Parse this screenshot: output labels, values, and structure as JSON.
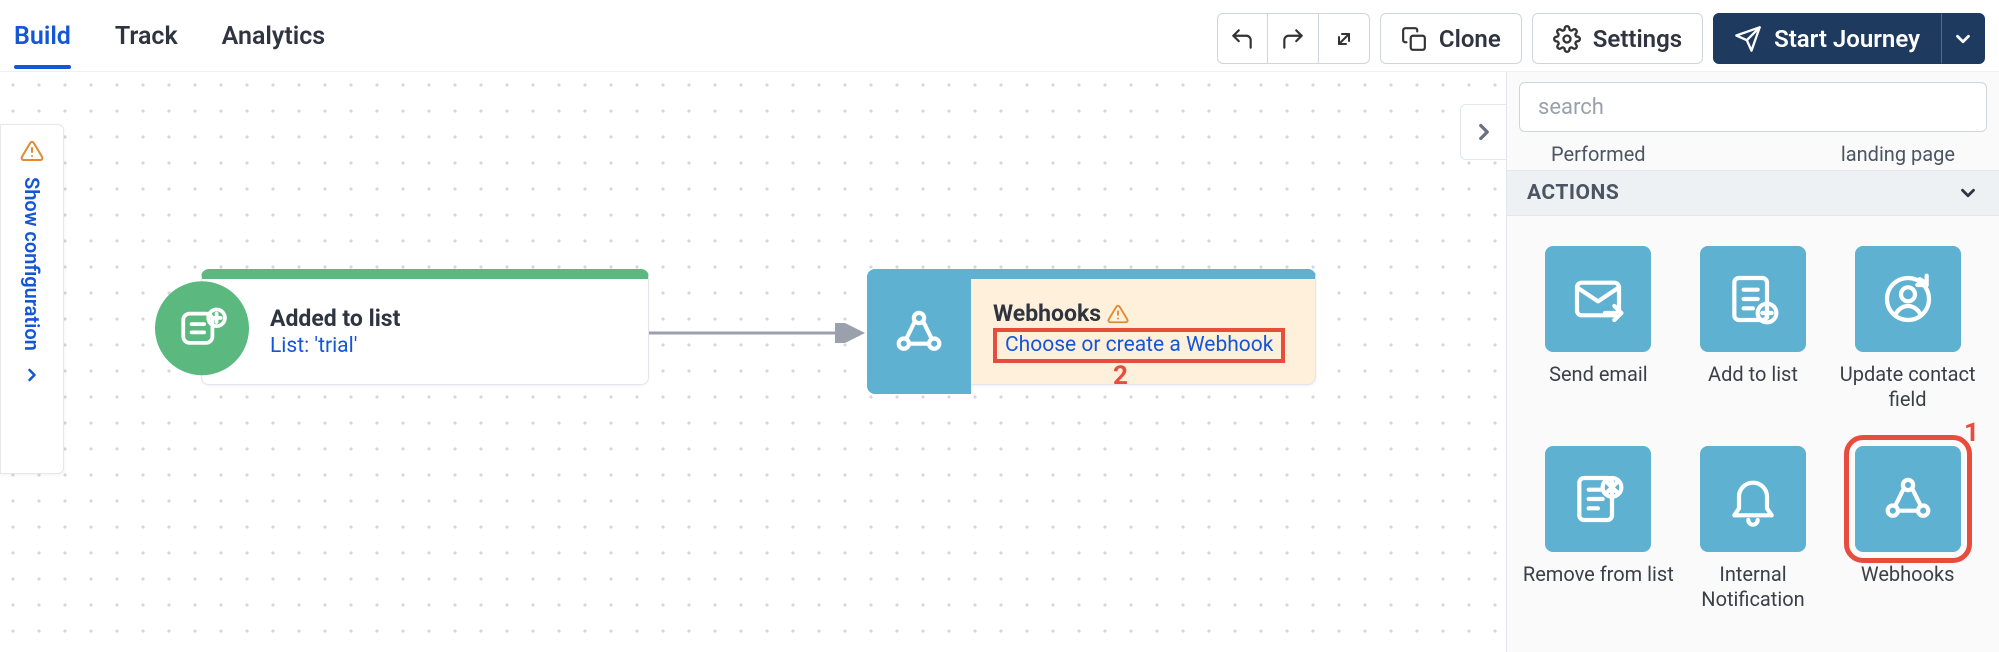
{
  "tabs": [
    "Build",
    "Track",
    "Analytics"
  ],
  "active_tab_index": 0,
  "toolbar": {
    "clone": "Clone",
    "settings": "Settings",
    "start": "Start Journey"
  },
  "side_toggle": "Show configuration",
  "trigger_node": {
    "title": "Added to list",
    "subtitle": "List: 'trial'"
  },
  "action_node": {
    "title": "Webhooks",
    "link": "Choose or create a Webhook"
  },
  "annotations": {
    "step1": "1",
    "step2": "2"
  },
  "palette": {
    "search_placeholder": "search",
    "partial_left": "Performed",
    "partial_right": "landing page",
    "section": "ACTIONS",
    "tiles": [
      {
        "label": "Send email",
        "icon": "mail-send"
      },
      {
        "label": "Add to list",
        "icon": "list-add"
      },
      {
        "label": "Update contact field",
        "icon": "contact-update"
      },
      {
        "label": "Remove from list",
        "icon": "list-remove"
      },
      {
        "label": "Internal Notification",
        "icon": "bell"
      },
      {
        "label": "Webhooks",
        "icon": "webhook",
        "highlight": true
      }
    ]
  }
}
